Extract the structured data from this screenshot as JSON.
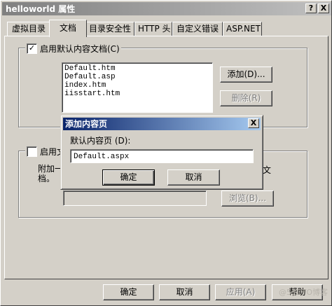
{
  "window": {
    "title": "helloworld 属性",
    "help_button": "?",
    "close_button": "X"
  },
  "tabs": [
    {
      "label": "虚拟目录"
    },
    {
      "label": "文档"
    },
    {
      "label": "目录安全性"
    },
    {
      "label": "HTTP 头"
    },
    {
      "label": "自定义错误"
    },
    {
      "label": "ASP.NET"
    }
  ],
  "default_docs": {
    "checkbox_label": "启用默认内容文档(C)",
    "checked": true,
    "items": [
      "Default.htm",
      "Default.asp",
      "index.htm",
      "iisstart.htm"
    ],
    "add_label": "添加(D)...",
    "remove_label": "删除(R)"
  },
  "footer_section": {
    "checkbox_label": "启用文",
    "checked": false,
    "desc_left": "附加一",
    "desc_left2": "档。",
    "desc_right": "文",
    "browse_label": "浏览(B)..."
  },
  "add_dialog": {
    "title": "添加内容页",
    "close_button": "X",
    "field_label": "默认内容页 (D):",
    "field_value": "Default.aspx",
    "ok_label": "确定",
    "cancel_label": "取消"
  },
  "bottom_buttons": {
    "ok": "确定",
    "cancel": "取消",
    "apply": "应用(A)",
    "help": "帮助"
  },
  "watermark": "@51CTO博客"
}
